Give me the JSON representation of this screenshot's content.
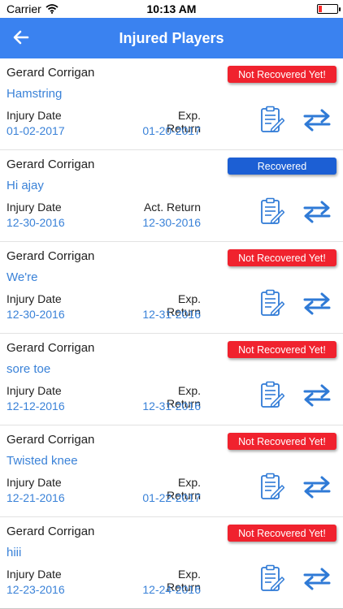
{
  "status_bar": {
    "carrier": "Carrier",
    "time": "10:13 AM"
  },
  "header": {
    "title": "Injured Players"
  },
  "icons": {
    "back": "back-arrow-icon",
    "edit": "edit-report-icon",
    "swap": "swap-arrows-icon"
  },
  "colors": {
    "nav": "#3a82f0",
    "not_recovered": "#f0222e",
    "recovered": "#1c5fd4",
    "link_text": "#3a82d8"
  },
  "players": [
    {
      "name": "Gerard Corrigan",
      "injury": "Hamstring",
      "status": "Not Recovered Yet!",
      "status_type": "red",
      "injury_date_label": "Injury Date",
      "injury_date": "01-02-2017",
      "return_label": "Exp. Return",
      "return_date": "01-20-2017"
    },
    {
      "name": "Gerard Corrigan",
      "injury": "Hi ajay",
      "status": "Recovered",
      "status_type": "blue",
      "injury_date_label": "Injury Date",
      "injury_date": "12-30-2016",
      "return_label": "Act. Return",
      "return_date": "12-30-2016"
    },
    {
      "name": "Gerard Corrigan",
      "injury": "We're",
      "status": "Not Recovered Yet!",
      "status_type": "red",
      "injury_date_label": "Injury Date",
      "injury_date": "12-30-2016",
      "return_label": "Exp. Return",
      "return_date": "12-31-2016"
    },
    {
      "name": "Gerard Corrigan",
      "injury": "sore toe",
      "status": "Not Recovered Yet!",
      "status_type": "red",
      "injury_date_label": "Injury Date",
      "injury_date": "12-12-2016",
      "return_label": "Exp. Return",
      "return_date": "12-31-2016"
    },
    {
      "name": "Gerard Corrigan",
      "injury": "Twisted knee",
      "status": "Not Recovered Yet!",
      "status_type": "red",
      "injury_date_label": "Injury Date",
      "injury_date": "12-21-2016",
      "return_label": "Exp. Return",
      "return_date": "01-22-2017"
    },
    {
      "name": "Gerard Corrigan",
      "injury": "hiii",
      "status": "Not Recovered Yet!",
      "status_type": "red",
      "injury_date_label": "Injury Date",
      "injury_date": "12-23-2016",
      "return_label": "Exp. Return",
      "return_date": "12-24-2016"
    }
  ]
}
